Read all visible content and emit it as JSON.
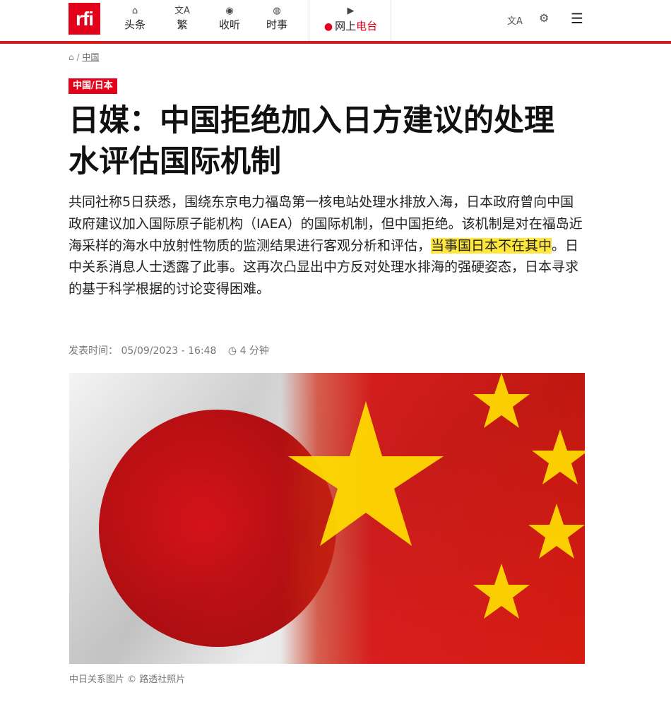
{
  "header": {
    "logo": "rfi",
    "nav": [
      {
        "label": "头条",
        "icon": "home-icon",
        "glyph": "⌂"
      },
      {
        "label": "繁",
        "icon": "translate-icon",
        "glyph": "文A"
      },
      {
        "label": "收听",
        "icon": "podcast-icon",
        "glyph": "◉"
      },
      {
        "label": "时事",
        "icon": "globe-icon",
        "glyph": "◍"
      }
    ],
    "live": {
      "prefix": "网上",
      "accent": "电台",
      "icon": "play-icon",
      "glyph": "▶"
    },
    "right_icons": [
      {
        "name": "language-icon",
        "glyph": "文A"
      },
      {
        "name": "settings-icon",
        "glyph": "⚙"
      },
      {
        "name": "menu-icon",
        "glyph": "☰"
      }
    ]
  },
  "breadcrumb": {
    "home_glyph": "⌂",
    "separator": "/",
    "section": "中国"
  },
  "article": {
    "tag": "中国/日本",
    "title": "日媒：中国拒绝加入日方建议的处理水评估国际机制",
    "lead_before": "共同社称5日获悉，围绕东京电力福岛第一核电站处理水排放入海，日本政府曾向中国政府建议加入国际原子能机构（IAEA）的国际机制，但中国拒绝。该机制是对在福岛近海采样的海水中放射性物质的监测结果进行客观分析和评估，",
    "lead_highlight": "当事国日本不在其中",
    "lead_after": "。日中关系消息人士透露了此事。这再次凸显出中方反对处理水排海的强硬姿态，日本寻求的基于科学根据的讨论变得困难。",
    "published_label": "发表时间：",
    "published_date": "05/09/2023 - 16:48",
    "read_icon_glyph": "◷",
    "read_time": "4 分钟",
    "image_caption": "中日关系图片 © 路透社照片"
  },
  "colors": {
    "brand": "#e2001a",
    "highlight": "#ffe63a",
    "flag_red": "#de2910",
    "flag_star": "#ffde00"
  }
}
